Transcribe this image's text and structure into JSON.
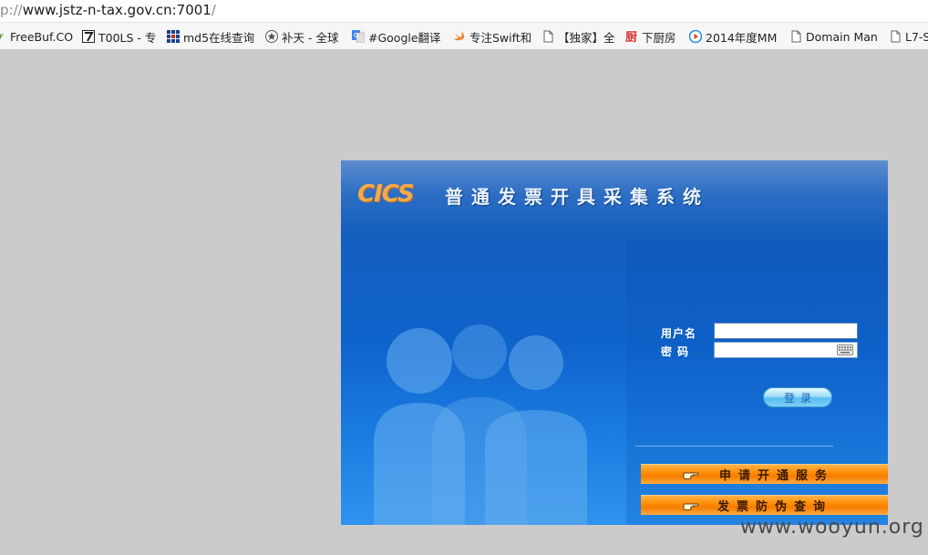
{
  "address_bar": {
    "protocol": "p://",
    "host": "www.jstz-n-tax.gov.cn:7001",
    "path": "/"
  },
  "bookmarks": [
    {
      "label": "FreeBuf.CO",
      "icon": "freebuf-icon"
    },
    {
      "label": "T00LS - 专",
      "icon": "tools-icon"
    },
    {
      "label": "md5在线查询",
      "icon": "grid-icon"
    },
    {
      "label": "补天 - 全球",
      "icon": "star-icon"
    },
    {
      "label": "#Google翻译",
      "icon": "translate-icon"
    },
    {
      "label": "专注Swift和",
      "icon": "swift-icon"
    },
    {
      "label": "【独家】全",
      "icon": "page-icon"
    },
    {
      "label": "下厨房",
      "icon": "xiachufang-icon"
    },
    {
      "label": "2014年度MM",
      "icon": "play-icon"
    },
    {
      "label": "Domain Man",
      "icon": "page-icon"
    },
    {
      "label": "L7-S",
      "icon": "page-icon"
    }
  ],
  "login": {
    "logo": "CICS",
    "title": "普通发票开具采集系统",
    "username_label": "用户名",
    "password_label": "密码",
    "username_value": "",
    "password_value": "",
    "login_button": "登录",
    "apply_service": "申请开通服务",
    "invoice_check": "发票防伪查询"
  },
  "watermark": "www.wooyun.org",
  "colors": {
    "page_bg": "#cbcbcb",
    "panel_blue": "#145fbe",
    "logo_orange": "#f5a94a",
    "service_orange": "#ff8a00"
  }
}
